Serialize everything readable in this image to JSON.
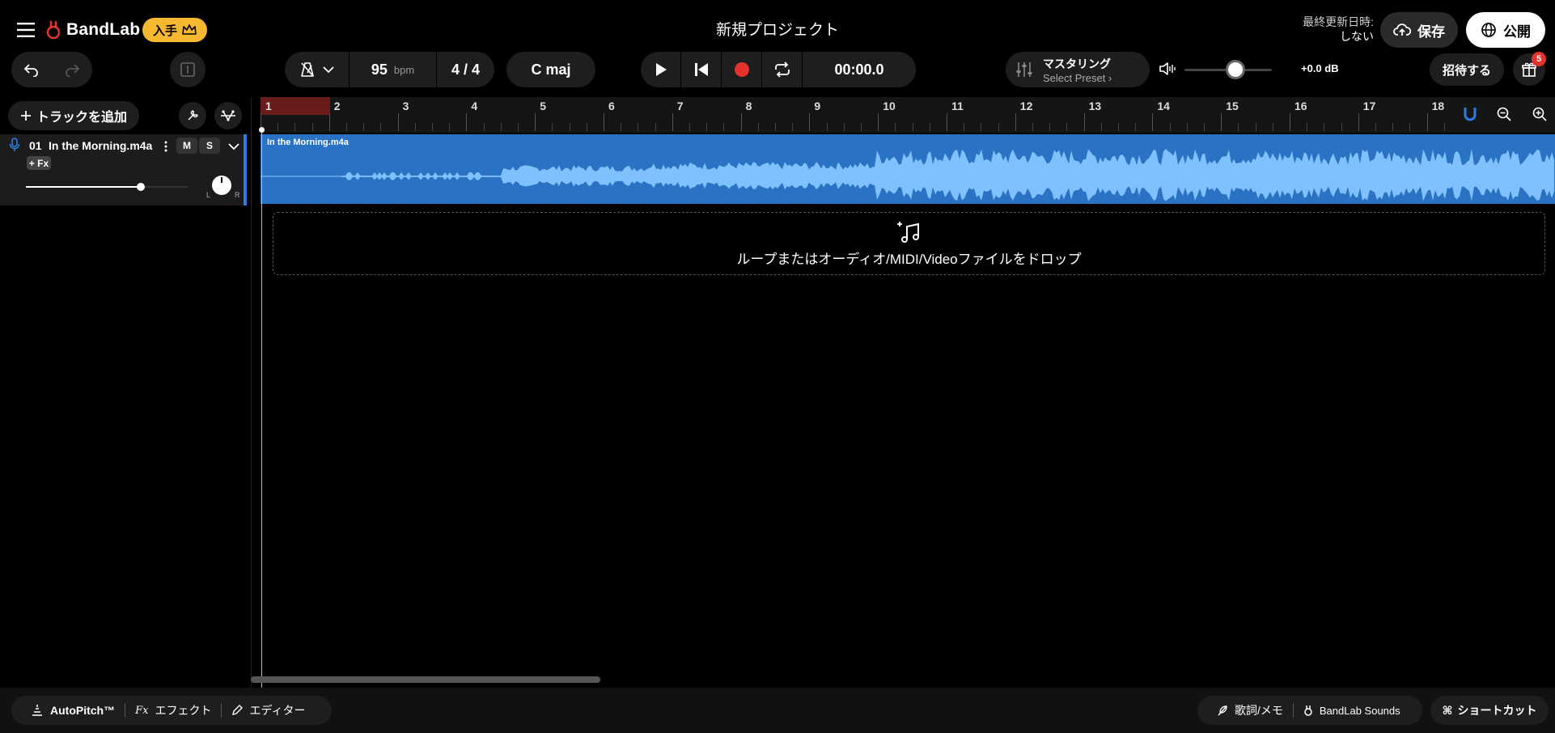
{
  "header": {
    "brand": "BandLab",
    "get_badge": "入手",
    "project_title": "新規プロジェクト",
    "last_updated_label": "最終更新日時:",
    "last_updated_value": "しない",
    "save_label": "保存",
    "publish_label": "公開"
  },
  "toolbar": {
    "tempo_value": "95",
    "tempo_unit": "bpm",
    "time_sig": "4 / 4",
    "key": "C maj",
    "time_display": "00:00.0",
    "mastering_title": "マスタリング",
    "mastering_preset": "Select Preset ›",
    "master_volume": 0.58,
    "db_readout": "+0.0 dB",
    "invite_label": "招待する",
    "gift_count": "5",
    "icons": {
      "menu": "hamburger-icon",
      "undo": "undo-icon",
      "redo": "redo-icon",
      "split": "split-icon",
      "metronome": "metronome-icon",
      "play": "play-icon",
      "rewind": "skip-back-icon",
      "record": "record-icon",
      "loop": "loop-icon",
      "mastering": "sliders-icon",
      "volume": "speaker-icon",
      "gift": "gift-icon"
    }
  },
  "tracks_panel": {
    "add_track_label": "トラックを追加",
    "track": {
      "number": "01",
      "name": "In the Morning.m4a",
      "fx_label": "+ Fx",
      "mute_label": "M",
      "solo_label": "S",
      "volume": 0.71,
      "pan_left": "L",
      "pan_right": "R"
    }
  },
  "timeline": {
    "bars": [
      "1",
      "2",
      "3",
      "4",
      "5",
      "6",
      "7",
      "8",
      "9",
      "10",
      "11",
      "12",
      "13",
      "14",
      "15",
      "16",
      "17",
      "18"
    ],
    "clip_name": "In the Morning.m4a",
    "drop_text": "ループまたはオーディオ/MIDI/Videoファイルをドロップ"
  },
  "bottom": {
    "autopitch": "AutoPitch™",
    "effects": "エフェクト",
    "editor": "エディター",
    "lyrics": "歌詞/メモ",
    "sounds": "BandLab Sounds",
    "shortcuts": "ショートカット"
  },
  "colors": {
    "accent_blue": "#2a72c4",
    "record_red": "#e5322d",
    "badge_yellow": "#f6b731"
  }
}
